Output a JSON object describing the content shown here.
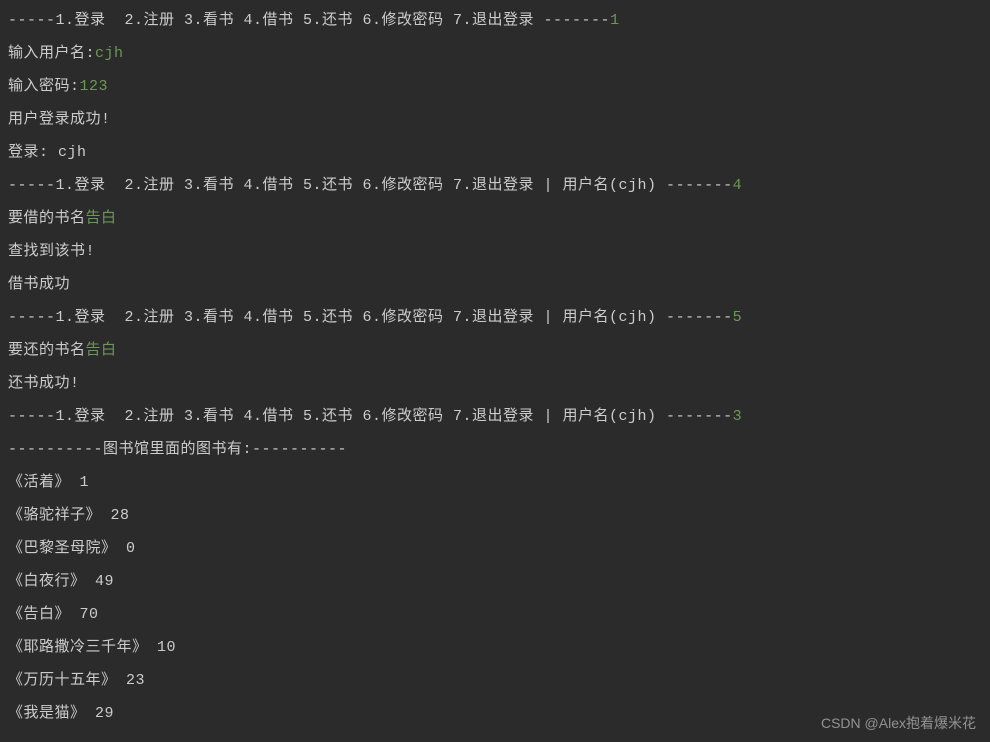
{
  "menu1": {
    "prefix": "-----",
    "text": "1.登录  2.注册 3.看书 4.借书 5.还书 6.修改密码 7.退出登录 -------",
    "choice": "1"
  },
  "login": {
    "username_prompt": "输入用户名:",
    "username_input": "cjh",
    "password_prompt": "输入密码:",
    "password_input": "123",
    "success_msg": "用户登录成功!",
    "logged_in_label": "登录: cjh"
  },
  "menu2": {
    "prefix": "-----",
    "text": "1.登录  2.注册 3.看书 4.借书 5.还书 6.修改密码 7.退出登录 | 用户名(cjh) -------",
    "choice": "4"
  },
  "borrow": {
    "prompt": "要借的书名",
    "book_input": "告白",
    "found_msg": "查找到该书!",
    "success_msg": "借书成功"
  },
  "menu3": {
    "prefix": "-----",
    "text": "1.登录  2.注册 3.看书 4.借书 5.还书 6.修改密码 7.退出登录 | 用户名(cjh) -------",
    "choice": "5"
  },
  "return": {
    "prompt": "要还的书名",
    "book_input": "告白",
    "success_msg": "还书成功!"
  },
  "menu4": {
    "prefix": "-----",
    "text": "1.登录  2.注册 3.看书 4.借书 5.还书 6.修改密码 7.退出登录 | 用户名(cjh) -------",
    "choice": "3"
  },
  "library": {
    "header": "----------图书馆里面的图书有:----------",
    "books": [
      "《活着》 1",
      "《骆驼祥子》 28",
      "《巴黎圣母院》 0",
      "《白夜行》 49",
      "《告白》 70",
      "《耶路撒冷三千年》 10",
      "《万历十五年》 23",
      "《我是猫》 29"
    ]
  },
  "watermark": "CSDN @Alex抱着爆米花"
}
